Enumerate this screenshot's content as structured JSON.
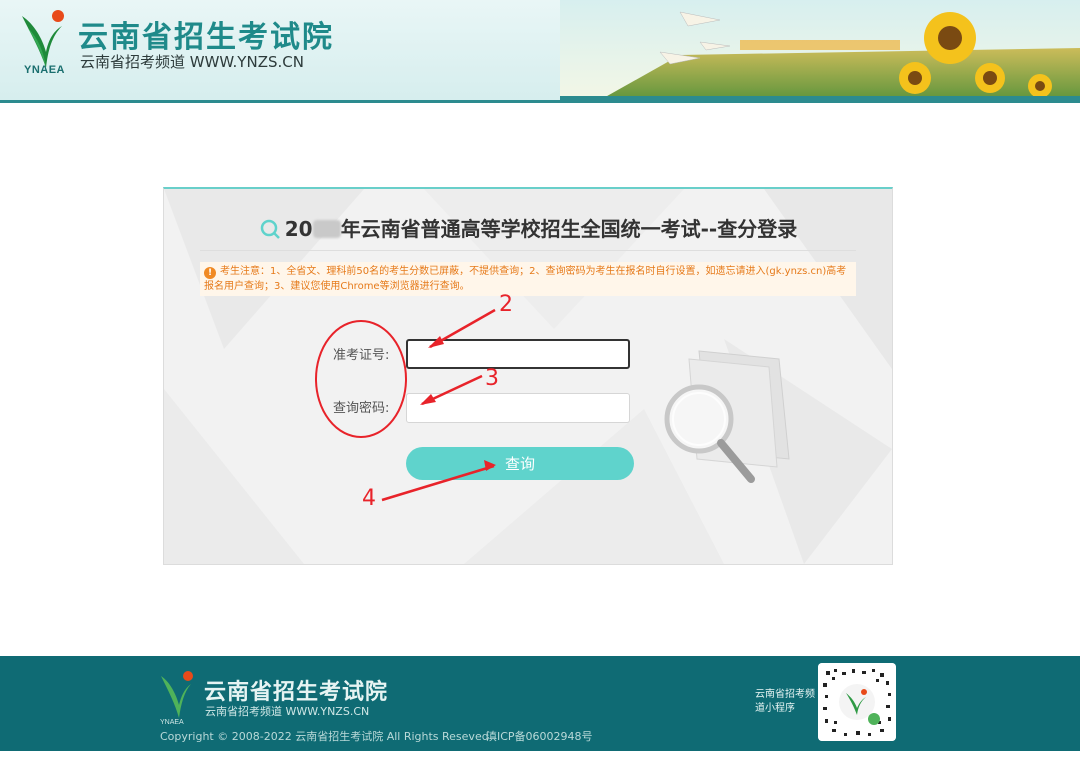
{
  "header": {
    "site_title": "云南省招生考试院",
    "site_subtitle": "云南省招考频道  WWW.YNZS.CN",
    "logo_abbr": "YNAEA"
  },
  "login": {
    "title_prefix": "20",
    "title_rest": "年云南省普通高等学校招生全国统一考试--查分登录",
    "notice": "考生注意：1、全省文、理科前50名的考生分数已屏蔽，不提供查询；2、查询密码为考生在报名时自行设置，如遗忘请进入(gk.ynzs.cn)高考报名用户查询；3、建议您使用Chrome等浏览器进行查询。",
    "exam_no_label": "准考证号:",
    "exam_no_value": "",
    "password_label": "查询密码:",
    "password_value": "",
    "submit_label": "查询"
  },
  "annotations": {
    "step_2": "2",
    "step_3": "3",
    "step_4": "4",
    "color": "#e8232a"
  },
  "footer": {
    "title": "云南省招生考试院",
    "subtitle": "云南省招考频道  WWW.YNZS.CN",
    "copyright": "Copyright © 2008-2022 云南省招生考试院  All Rights Reseved",
    "icp": "滇ICP备06002948号",
    "miniprogram_label": "云南省招考频道小程序"
  },
  "colors": {
    "accent": "#5fd3cc",
    "brand": "#1f8a8a",
    "footer_bg": "#0f6b74",
    "notice": "#e67a1a"
  },
  "icons": [
    "logo-mark",
    "search-icon",
    "warning-icon",
    "magnifier-decoration",
    "qr-code"
  ]
}
